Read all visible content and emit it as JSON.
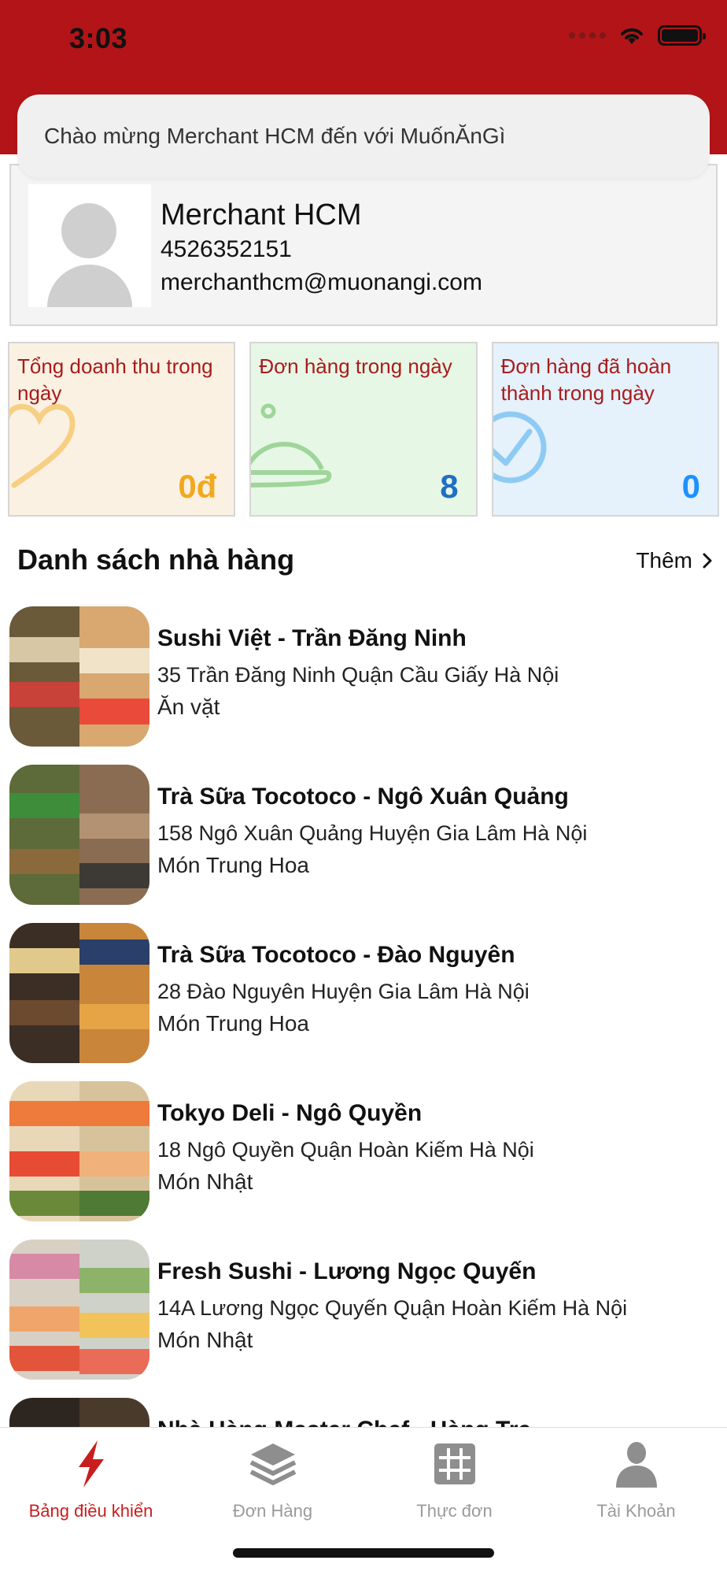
{
  "status_bar": {
    "time": "3:03"
  },
  "welcome": "Chào mừng Merchant HCM đến với MuốnĂnGì",
  "profile": {
    "name": "Merchant HCM",
    "phone": "4526352151",
    "email": "merchanthcm@muonangi.com"
  },
  "stats": [
    {
      "label": "Tổng doanh thu trong ngày",
      "value": "0đ",
      "icon": "heart-icon",
      "color": "#f2a81e"
    },
    {
      "label": "Đơn hàng trong ngày",
      "value": "8",
      "icon": "food-cloche-icon",
      "color": "#1f6fc4"
    },
    {
      "label": "Đơn hàng đã hoàn thành trong ngày",
      "value": "0",
      "icon": "checkmark-circle-icon",
      "color": "#1e90ff"
    }
  ],
  "section": {
    "title": "Danh sách nhà hàng",
    "more": "Thêm"
  },
  "restaurants": [
    {
      "name": "Sushi Việt - Trần Đăng Ninh",
      "address": "35 Trần Đăng Ninh Quận Cầu Giấy Hà Nội",
      "category": "Ăn vặt"
    },
    {
      "name": "Trà Sữa Tocotoco - Ngô Xuân Quảng",
      "address": "158 Ngô Xuân Quảng Huyện Gia Lâm Hà Nội",
      "category": "Món Trung Hoa"
    },
    {
      "name": "Trà Sữa Tocotoco - Đào Nguyên",
      "address": "28 Đào Nguyên Huyện Gia Lâm Hà Nội",
      "category": "Món Trung Hoa"
    },
    {
      "name": "Tokyo Deli - Ngô Quyền",
      "address": "18 Ngô Quyền Quận Hoàn Kiếm Hà Nội",
      "category": "Món Nhật"
    },
    {
      "name": "Fresh Sushi - Lương Ngọc Quyến",
      "address": "14A Lương Ngọc Quyến Quận Hoàn Kiếm Hà Nội",
      "category": "Món Nhật"
    },
    {
      "name": "Nhà Hàng Master Chef - Hàng Tre",
      "address": "",
      "category": ""
    }
  ],
  "tabs": [
    {
      "label": "Bảng điều khiển",
      "icon": "lightning-icon",
      "active": true
    },
    {
      "label": "Đơn Hàng",
      "icon": "layers-icon",
      "active": false
    },
    {
      "label": "Thực đơn",
      "icon": "grid-icon",
      "active": false
    },
    {
      "label": "Tài Khoản",
      "icon": "person-icon",
      "active": false
    }
  ],
  "colors": {
    "brand": "#b31417",
    "active_tab": "#c81e1e",
    "inactive_tab": "#9a9a9a"
  }
}
